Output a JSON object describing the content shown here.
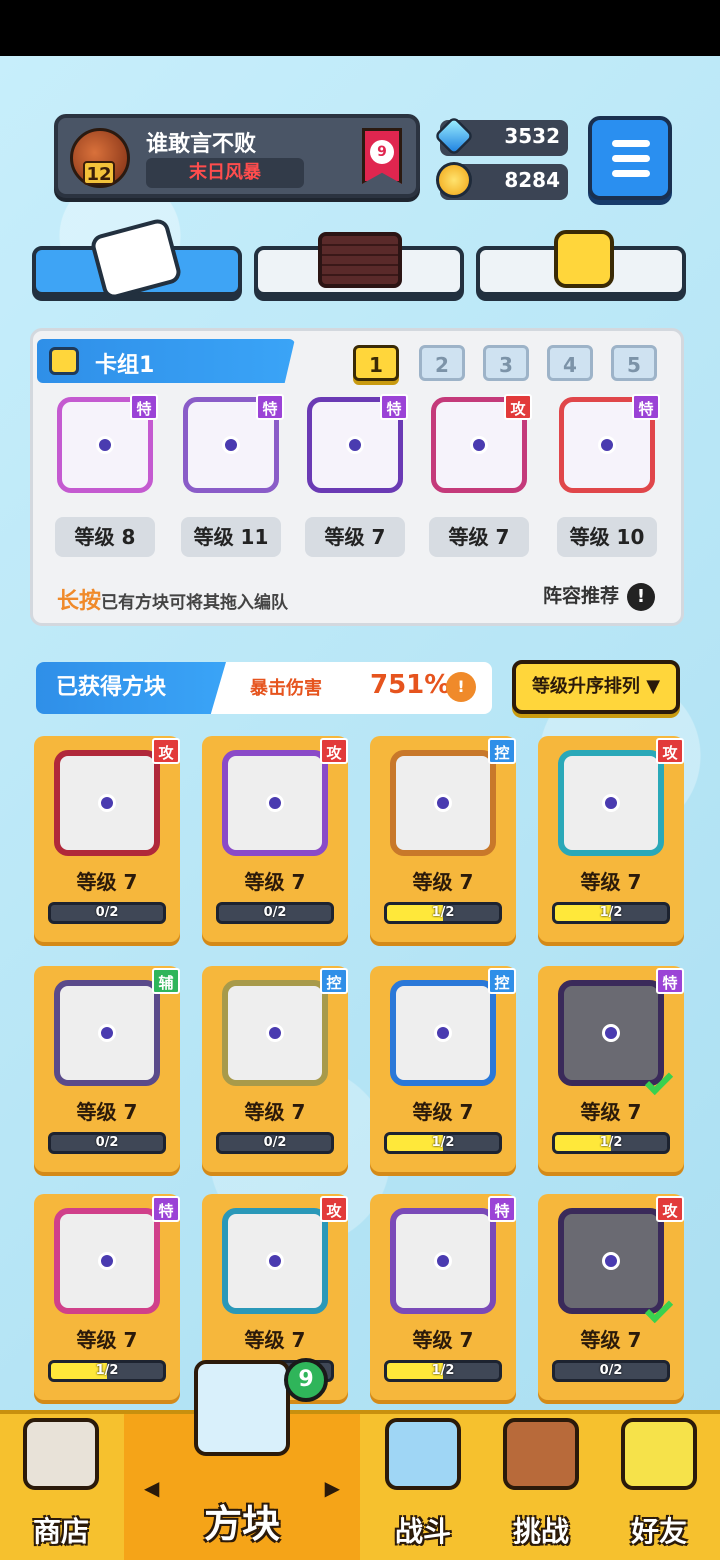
{
  "player": {
    "level": "12",
    "name": "谁敢言不败",
    "title": "末日风暴",
    "rank": "9"
  },
  "currency": {
    "gems": "3532",
    "gold": "8284"
  },
  "tabs": [
    {
      "name": "dice-tab",
      "icon": "dice-icon"
    },
    {
      "name": "grid-tab",
      "icon": "grid-board-icon"
    },
    {
      "name": "emote-tab",
      "icon": "smiley-block-icon"
    }
  ],
  "deck": {
    "title": "卡组1",
    "numbers": [
      "1",
      "2",
      "3",
      "4",
      "5"
    ],
    "active_index": 0,
    "cards": [
      {
        "tag": "特",
        "tag_color": "purple",
        "level": "等级 8",
        "frame": "#c45ad0"
      },
      {
        "tag": "特",
        "tag_color": "purple",
        "level": "等级 11",
        "frame": "#8a5cc8"
      },
      {
        "tag": "特",
        "tag_color": "purple",
        "level": "等级 7",
        "frame": "#6a3ab4"
      },
      {
        "tag": "攻",
        "tag_color": "red",
        "level": "等级 7",
        "frame": "#c43a7a"
      },
      {
        "tag": "特",
        "tag_color": "purple",
        "level": "等级 10",
        "frame": "#e0464a"
      }
    ],
    "hint_strong": "长按",
    "hint_rest": "已有方块可将其拖入编队",
    "recommend_label": "阵容推荐"
  },
  "obtained": {
    "title": "已获得方块",
    "crit_label": "暴击伤害",
    "crit_value": "751%",
    "sort_label": "等级升序排列 ▼"
  },
  "blocks": [
    {
      "tag": "攻",
      "tag_color": "red",
      "level": "等级 7",
      "progress_text": "0/2",
      "progress": 0,
      "frame": "#b0283a",
      "check": false
    },
    {
      "tag": "攻",
      "tag_color": "red",
      "level": "等级 7",
      "progress_text": "0/2",
      "progress": 0,
      "frame": "#8a4ac8",
      "check": false
    },
    {
      "tag": "控",
      "tag_color": "blue",
      "level": "等级 7",
      "progress_text": "1/2",
      "progress": 0.5,
      "frame": "#c8782a",
      "check": false
    },
    {
      "tag": "攻",
      "tag_color": "red",
      "level": "等级 7",
      "progress_text": "1/2",
      "progress": 0.5,
      "frame": "#2aa8b8",
      "check": false
    },
    {
      "tag": "辅",
      "tag_color": "green",
      "level": "等级 7",
      "progress_text": "0/2",
      "progress": 0,
      "frame": "#5a4a8a",
      "check": false
    },
    {
      "tag": "控",
      "tag_color": "blue",
      "level": "等级 7",
      "progress_text": "0/2",
      "progress": 0,
      "frame": "#a89a4a",
      "check": false
    },
    {
      "tag": "控",
      "tag_color": "blue",
      "level": "等级 7",
      "progress_text": "1/2",
      "progress": 0.5,
      "frame": "#2a78d8",
      "check": false
    },
    {
      "tag": "特",
      "tag_color": "purple",
      "level": "等级 7",
      "progress_text": "1/2",
      "progress": 0.5,
      "frame": "#3a2a5a",
      "check": true
    },
    {
      "tag": "特",
      "tag_color": "purple",
      "level": "等级 7",
      "progress_text": "1/2",
      "progress": 0.5,
      "frame": "#d0408a",
      "check": false
    },
    {
      "tag": "攻",
      "tag_color": "red",
      "level": "等级 7",
      "progress_text": "0/2",
      "progress": 0,
      "frame": "#2a98b8",
      "check": false
    },
    {
      "tag": "特",
      "tag_color": "purple",
      "level": "等级 7",
      "progress_text": "1/2",
      "progress": 0.5,
      "frame": "#7a4ab8",
      "check": false
    },
    {
      "tag": "攻",
      "tag_color": "red",
      "level": "等级 7",
      "progress_text": "0/2",
      "progress": 0,
      "frame": "#3a2a5a",
      "check": true
    }
  ],
  "nav": {
    "shop": "商店",
    "block": "方块",
    "battle": "战斗",
    "challenge": "挑战",
    "friends": "好友",
    "block_badge": "9",
    "arrow_left": "◀",
    "arrow_right": "▶"
  },
  "colors": {
    "accent_blue": "#2f8fe8",
    "accent_yellow": "#ffd63b",
    "crit_orange": "#e6541e",
    "card_bg": "#f6b73c"
  }
}
